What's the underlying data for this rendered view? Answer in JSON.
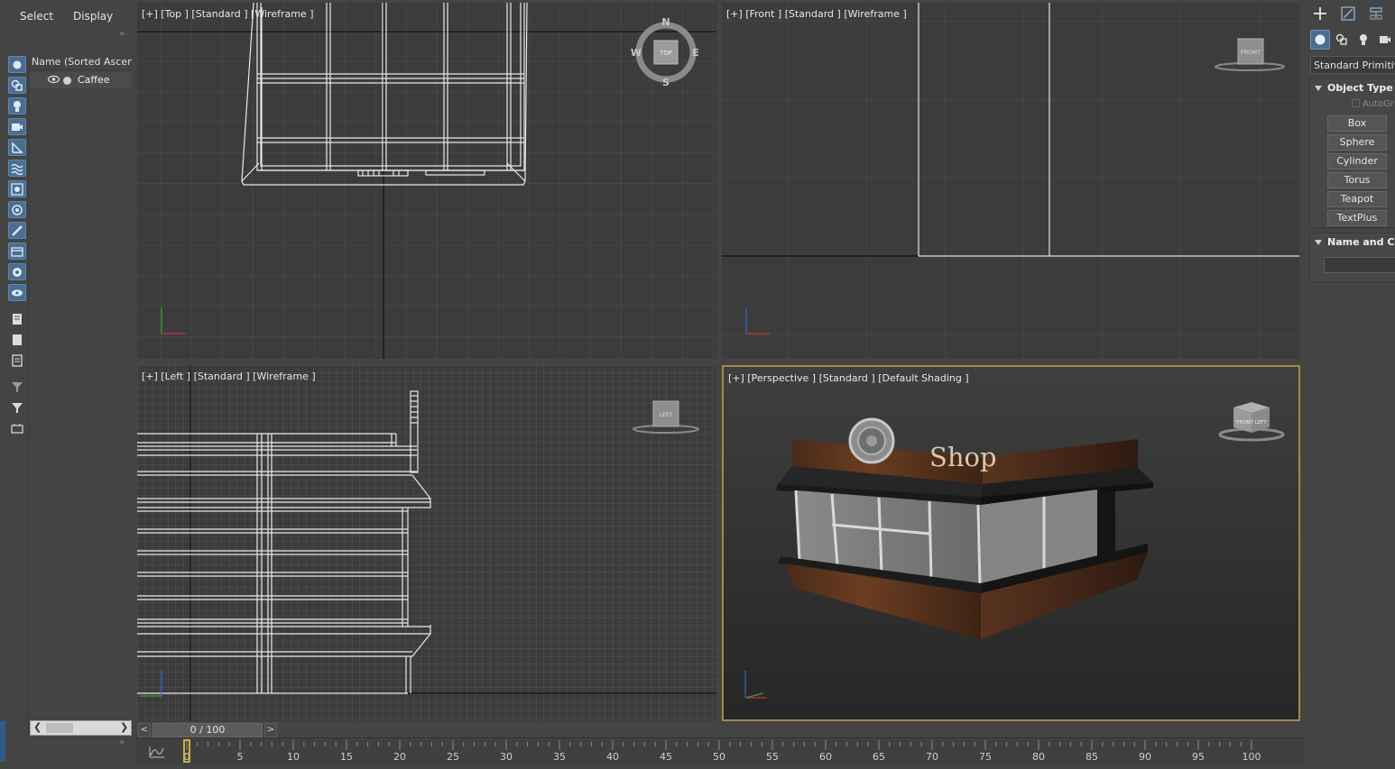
{
  "explorer": {
    "tabs": [
      "Select",
      "Display"
    ],
    "column_header": "Name (Sorted Ascending)",
    "items": [
      {
        "label": "Caffee"
      }
    ],
    "more_glyph": "»"
  },
  "viewports": {
    "top": {
      "label": "[+] [Top ] [Standard ] [Wireframe ]",
      "viewcube": "TOP",
      "compass": [
        "N",
        "E",
        "S",
        "W"
      ]
    },
    "front": {
      "label": "[+] [Front ] [Standard ] [Wireframe ]",
      "viewcube": "FRONT"
    },
    "left": {
      "label": "[+] [Left ] [Standard ] [Wireframe ]",
      "viewcube": "LEFT"
    },
    "perspective": {
      "label": "[+] [Perspective ] [Standard ] [Default Shading ]",
      "sign_text": "Shop",
      "viewcube": "FRONT LEFT"
    }
  },
  "command_panel": {
    "category": "Standard Primitives",
    "object_type_title": "Object Type",
    "autogrid_label": "AutoGrid",
    "primitives": [
      "Box",
      "Sphere",
      "Cylinder",
      "Torus",
      "Teapot",
      "TextPlus"
    ],
    "name_color_title": "Name and Color"
  },
  "timeline": {
    "frame_display": "0 / 100",
    "prev_label": "<",
    "next_label": ">",
    "ticks": [
      "0",
      "5",
      "10",
      "15",
      "20",
      "25",
      "30",
      "35",
      "40",
      "45",
      "50",
      "55",
      "60",
      "65",
      "70",
      "75",
      "80",
      "85",
      "90",
      "95",
      "100"
    ]
  },
  "colors": {
    "accent_blue": "#4a6e93",
    "active_viewport_border": "#a08a4a",
    "time_marker": "#c8b040"
  }
}
